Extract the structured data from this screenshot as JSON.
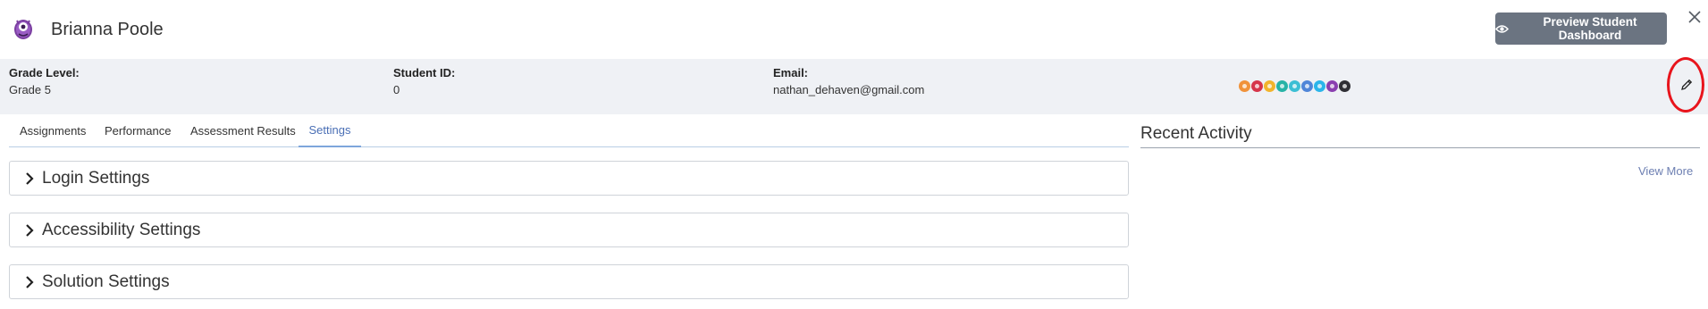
{
  "header": {
    "student_name": "Brianna Poole",
    "preview_button_label": "Preview Student Dashboard",
    "avatar_icon": "purple-monster-icon",
    "preview_icon": "eye-icon",
    "close_icon": "close-icon"
  },
  "info": {
    "grade_level_label": "Grade Level:",
    "grade_level_value": "Grade 5",
    "student_id_label": "Student ID:",
    "student_id_value": "0",
    "email_label": "Email:",
    "email_value": "nathan_dehaven@gmail.com",
    "badge_colors": [
      "#f0923a",
      "#d6354a",
      "#f2b42c",
      "#27b3a6",
      "#3bbfd4",
      "#4f86d8",
      "#2bb5ea",
      "#8a3fb0",
      "#2f2f35"
    ],
    "edit_icon": "pencil-icon"
  },
  "tabs": [
    {
      "label": "Assignments",
      "active": false
    },
    {
      "label": "Performance",
      "active": false
    },
    {
      "label": "Assessment Results",
      "active": false
    },
    {
      "label": "Settings",
      "active": true
    }
  ],
  "panels": [
    {
      "title": "Login Settings"
    },
    {
      "title": "Accessibility Settings"
    },
    {
      "title": "Solution Settings"
    }
  ],
  "recent_activity": {
    "title": "Recent Activity",
    "view_more": "View More"
  },
  "colors": {
    "info_bar_bg": "#eff1f5",
    "button_bg": "#6b7481",
    "active_tab": "#4a6fb5",
    "highlight": "#e8141c"
  }
}
